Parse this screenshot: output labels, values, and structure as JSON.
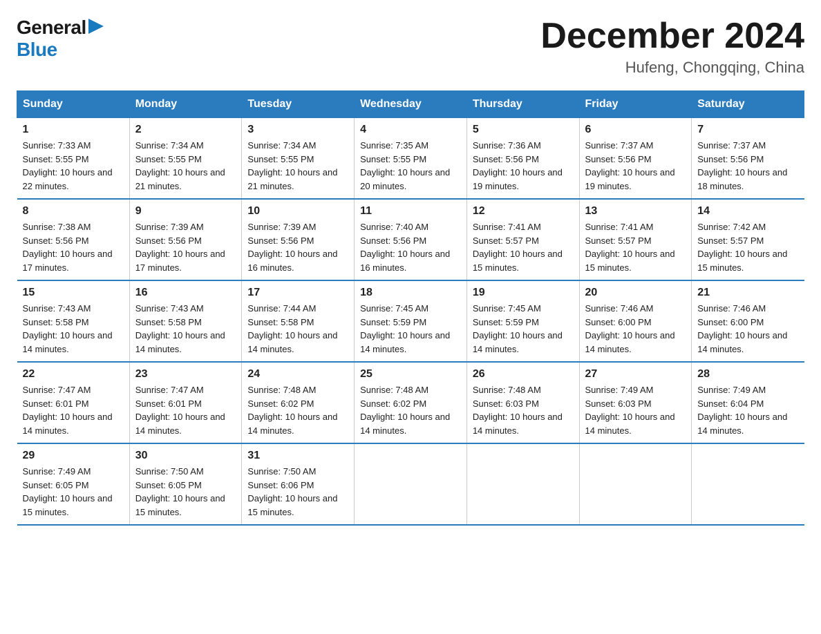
{
  "logo": {
    "general": "General",
    "blue": "Blue"
  },
  "title": "December 2024",
  "location": "Hufeng, Chongqing, China",
  "days_of_week": [
    "Sunday",
    "Monday",
    "Tuesday",
    "Wednesday",
    "Thursday",
    "Friday",
    "Saturday"
  ],
  "weeks": [
    [
      {
        "day": "1",
        "sunrise": "7:33 AM",
        "sunset": "5:55 PM",
        "daylight": "10 hours and 22 minutes."
      },
      {
        "day": "2",
        "sunrise": "7:34 AM",
        "sunset": "5:55 PM",
        "daylight": "10 hours and 21 minutes."
      },
      {
        "day": "3",
        "sunrise": "7:34 AM",
        "sunset": "5:55 PM",
        "daylight": "10 hours and 21 minutes."
      },
      {
        "day": "4",
        "sunrise": "7:35 AM",
        "sunset": "5:55 PM",
        "daylight": "10 hours and 20 minutes."
      },
      {
        "day": "5",
        "sunrise": "7:36 AM",
        "sunset": "5:56 PM",
        "daylight": "10 hours and 19 minutes."
      },
      {
        "day": "6",
        "sunrise": "7:37 AM",
        "sunset": "5:56 PM",
        "daylight": "10 hours and 19 minutes."
      },
      {
        "day": "7",
        "sunrise": "7:37 AM",
        "sunset": "5:56 PM",
        "daylight": "10 hours and 18 minutes."
      }
    ],
    [
      {
        "day": "8",
        "sunrise": "7:38 AM",
        "sunset": "5:56 PM",
        "daylight": "10 hours and 17 minutes."
      },
      {
        "day": "9",
        "sunrise": "7:39 AM",
        "sunset": "5:56 PM",
        "daylight": "10 hours and 17 minutes."
      },
      {
        "day": "10",
        "sunrise": "7:39 AM",
        "sunset": "5:56 PM",
        "daylight": "10 hours and 16 minutes."
      },
      {
        "day": "11",
        "sunrise": "7:40 AM",
        "sunset": "5:56 PM",
        "daylight": "10 hours and 16 minutes."
      },
      {
        "day": "12",
        "sunrise": "7:41 AM",
        "sunset": "5:57 PM",
        "daylight": "10 hours and 15 minutes."
      },
      {
        "day": "13",
        "sunrise": "7:41 AM",
        "sunset": "5:57 PM",
        "daylight": "10 hours and 15 minutes."
      },
      {
        "day": "14",
        "sunrise": "7:42 AM",
        "sunset": "5:57 PM",
        "daylight": "10 hours and 15 minutes."
      }
    ],
    [
      {
        "day": "15",
        "sunrise": "7:43 AM",
        "sunset": "5:58 PM",
        "daylight": "10 hours and 14 minutes."
      },
      {
        "day": "16",
        "sunrise": "7:43 AM",
        "sunset": "5:58 PM",
        "daylight": "10 hours and 14 minutes."
      },
      {
        "day": "17",
        "sunrise": "7:44 AM",
        "sunset": "5:58 PM",
        "daylight": "10 hours and 14 minutes."
      },
      {
        "day": "18",
        "sunrise": "7:45 AM",
        "sunset": "5:59 PM",
        "daylight": "10 hours and 14 minutes."
      },
      {
        "day": "19",
        "sunrise": "7:45 AM",
        "sunset": "5:59 PM",
        "daylight": "10 hours and 14 minutes."
      },
      {
        "day": "20",
        "sunrise": "7:46 AM",
        "sunset": "6:00 PM",
        "daylight": "10 hours and 14 minutes."
      },
      {
        "day": "21",
        "sunrise": "7:46 AM",
        "sunset": "6:00 PM",
        "daylight": "10 hours and 14 minutes."
      }
    ],
    [
      {
        "day": "22",
        "sunrise": "7:47 AM",
        "sunset": "6:01 PM",
        "daylight": "10 hours and 14 minutes."
      },
      {
        "day": "23",
        "sunrise": "7:47 AM",
        "sunset": "6:01 PM",
        "daylight": "10 hours and 14 minutes."
      },
      {
        "day": "24",
        "sunrise": "7:48 AM",
        "sunset": "6:02 PM",
        "daylight": "10 hours and 14 minutes."
      },
      {
        "day": "25",
        "sunrise": "7:48 AM",
        "sunset": "6:02 PM",
        "daylight": "10 hours and 14 minutes."
      },
      {
        "day": "26",
        "sunrise": "7:48 AM",
        "sunset": "6:03 PM",
        "daylight": "10 hours and 14 minutes."
      },
      {
        "day": "27",
        "sunrise": "7:49 AM",
        "sunset": "6:03 PM",
        "daylight": "10 hours and 14 minutes."
      },
      {
        "day": "28",
        "sunrise": "7:49 AM",
        "sunset": "6:04 PM",
        "daylight": "10 hours and 14 minutes."
      }
    ],
    [
      {
        "day": "29",
        "sunrise": "7:49 AM",
        "sunset": "6:05 PM",
        "daylight": "10 hours and 15 minutes."
      },
      {
        "day": "30",
        "sunrise": "7:50 AM",
        "sunset": "6:05 PM",
        "daylight": "10 hours and 15 minutes."
      },
      {
        "day": "31",
        "sunrise": "7:50 AM",
        "sunset": "6:06 PM",
        "daylight": "10 hours and 15 minutes."
      },
      null,
      null,
      null,
      null
    ]
  ]
}
